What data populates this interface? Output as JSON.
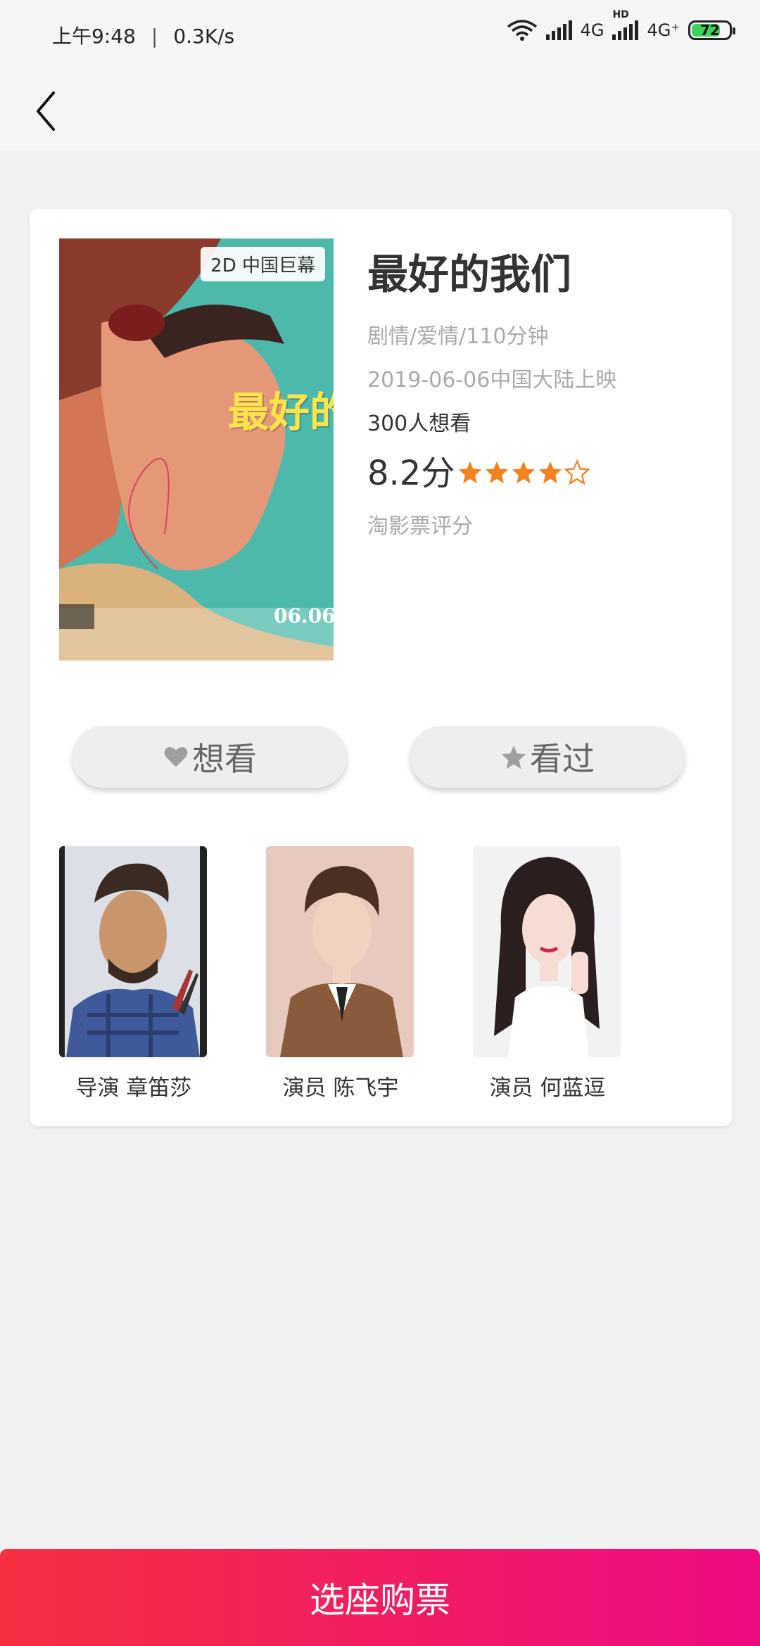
{
  "status_bar": {
    "time": "上午9:48",
    "net_speed": "0.3K/s",
    "network_1": "4G",
    "hd_label": "HD",
    "network_2": "4G⁺",
    "battery_level": "72"
  },
  "nav": {
    "back_icon": "chevron-left-icon"
  },
  "movie": {
    "poster_tag": "2D 中国巨幕",
    "poster_title": "最好的我们",
    "poster_date": "06.06",
    "title": "最好的我们",
    "genre": "剧情/爱情/110分钟",
    "release": "2019-06-06中国大陆上映",
    "want_count": "300人想看",
    "score": "8.2分",
    "rating_stars": 4,
    "rating_max": 5,
    "score_source": "淘影票评分"
  },
  "actions": {
    "want_label": "想看",
    "want_icon": "heart-icon",
    "seen_label": "看过",
    "seen_icon": "star-icon"
  },
  "cast": [
    {
      "role_name": "导演 章笛莎"
    },
    {
      "role_name": "演员 陈飞宇"
    },
    {
      "role_name": "演员 何蓝逗"
    }
  ],
  "buy_button": {
    "label": "选座购票"
  },
  "colors": {
    "star": "#f5811f",
    "buy_gradient_start": "#f53040",
    "buy_gradient_end": "#ee0a83",
    "battery": "#3bd35a"
  }
}
